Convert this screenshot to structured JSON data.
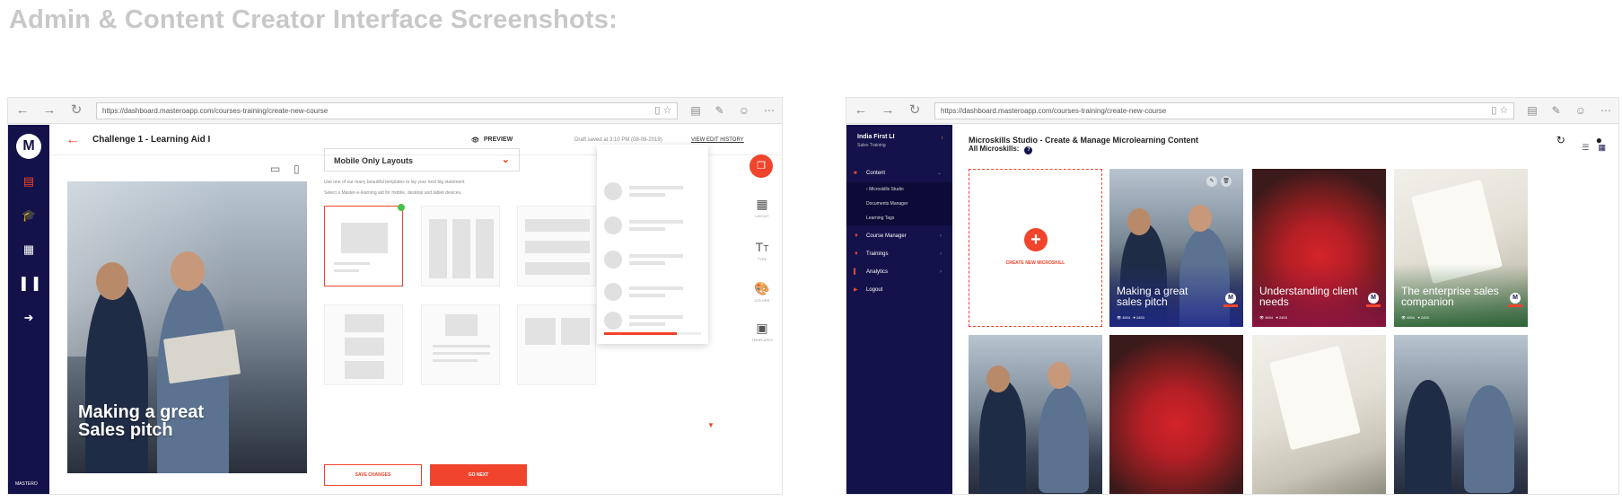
{
  "page": {
    "heading": "Admin & Content Creator Interface Screenshots:"
  },
  "browser": {
    "url": "https://dashboard.masteroapp.com/courses-training/create-new-course"
  },
  "left": {
    "logo": "M",
    "title": "Challenge 1 - Learning Aid I",
    "preview": "PREVIEW",
    "draft": "Draft saved at 3:10 PM (08-09-2019)",
    "version": "VIEW EDIT HISTORY",
    "card_text": "Making a great Sales pitch",
    "layout_select": "Mobile Only Layouts",
    "helper1": "Use one of our many beautiful templates to lay your next big statement",
    "helper2": "Select a Master-e-learning aid for mobile, desktop and tablet devices.",
    "tools": {
      "layout": "LAYOUT",
      "type": "TYPE",
      "colors": "COLORS",
      "templates": "TEMPLATES"
    },
    "save_label": "SAVE CHANGES",
    "next_label": "GO NEXT",
    "footer": "MASTERO",
    "progress": 0.75
  },
  "right": {
    "org_name": "India First LI",
    "org_sub": "Sales Training",
    "title": "Microskills Studio - Create & Manage Microlearning Content",
    "all_label": "All Microskills:",
    "menu": {
      "content": "Content",
      "studio": "Microskills Studio",
      "documents": "Documents Manager",
      "tags": "Learning Tags",
      "course": "Course Manager",
      "trainings": "Trainings",
      "analytics": "Analytics",
      "logout": "Logout"
    },
    "create_label": "CREATE NEW MICROSKILL",
    "tiles": [
      {
        "name": "Making a great sales pitch",
        "views": "4504",
        "likes": "2453"
      },
      {
        "name": "Understanding client needs",
        "views": "4504",
        "likes": "2453"
      },
      {
        "name": "The enterprise sales companion",
        "views": "4504",
        "likes": "2453"
      }
    ]
  },
  "colors": {
    "accent": "#f0442c",
    "navy": "#13124a"
  }
}
